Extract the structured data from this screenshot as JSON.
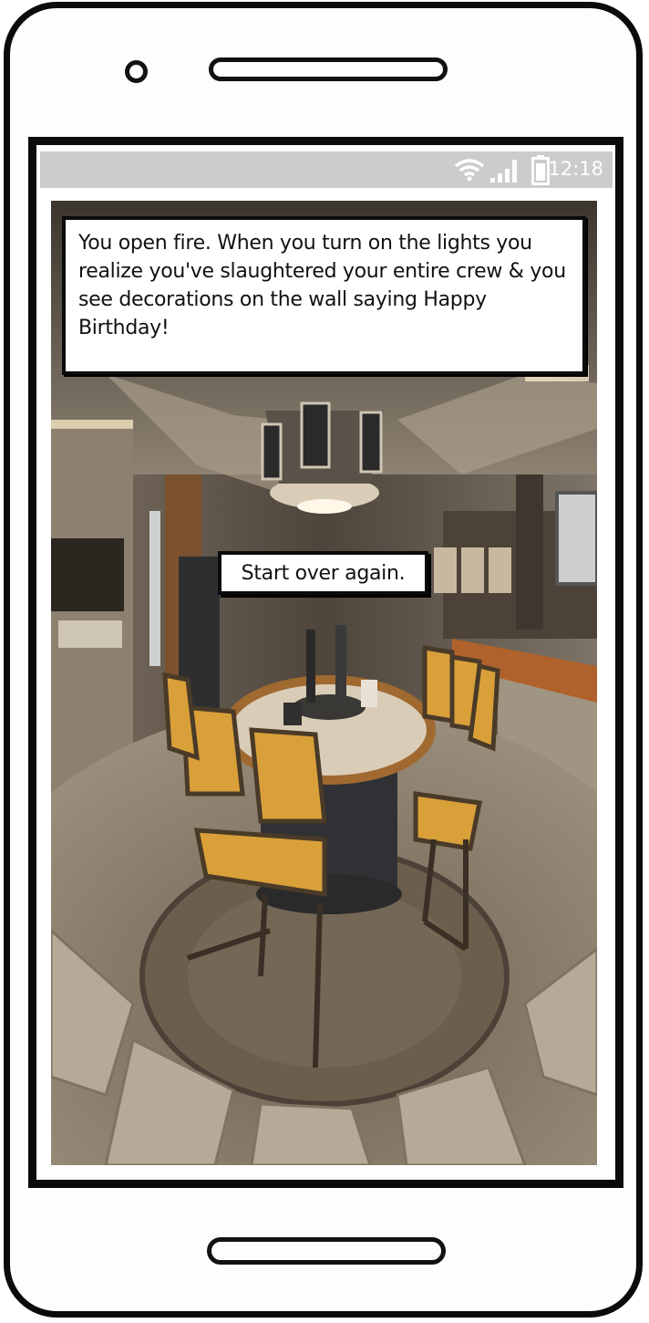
{
  "status_bar": {
    "time": "12:18",
    "icons": [
      "wifi-icon",
      "signal-icon",
      "battery-icon"
    ]
  },
  "story": {
    "message": "You open fire. When you turn on the lights you realize you've slaughtered your entire crew & you see decorations on the wall saying Happy Birthday!",
    "start_over_label": "Start over again."
  },
  "colors": {
    "status_bar_bg": "#cccccc",
    "frame": "#0b0b0b",
    "chair_yellow": "#d9a03a"
  }
}
